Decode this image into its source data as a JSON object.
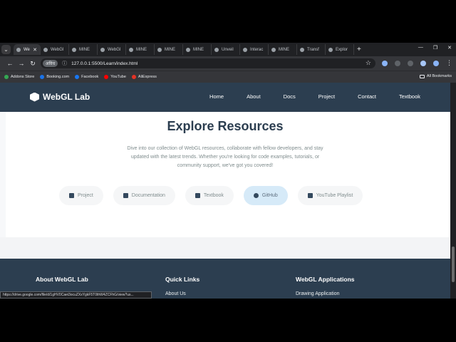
{
  "browser": {
    "tabs": [
      {
        "label": "We",
        "active": true
      },
      {
        "label": "WebGl"
      },
      {
        "label": "MINE"
      },
      {
        "label": "WebGl"
      },
      {
        "label": "MINE"
      },
      {
        "label": "MINE"
      },
      {
        "label": "MINE"
      },
      {
        "label": "Unveil"
      },
      {
        "label": "Interac"
      },
      {
        "label": "MINE"
      },
      {
        "label": "Transf"
      },
      {
        "label": "Explor"
      }
    ],
    "url": "127.0.0.1:5500/Learn/index.html",
    "chip": "अविध",
    "bookmarks": [
      {
        "label": "Addons Store",
        "color": "#34a853"
      },
      {
        "label": "Booking.com",
        "color": "#1a73e8"
      },
      {
        "label": "Facebook",
        "color": "#1877f2"
      },
      {
        "label": "YouTube",
        "color": "#ff0000"
      },
      {
        "label": "AliExpress",
        "color": "#e43225"
      }
    ],
    "all_bookmarks": "All Bookmarks",
    "status_url": "https://drive.google.com/file/d/1gHV0Caei3ocuZXsYgkF5T0thW4ZCFhG/view?us..."
  },
  "site": {
    "logo": "WebGL Lab",
    "nav": [
      "Home",
      "About",
      "Docs",
      "Project",
      "Contact",
      "Textbook"
    ],
    "heading": "Explore Resources",
    "paragraph": "Dive into our collection of WebGL resources, collaborate with fellow developers, and stay updated with the latest trends. Whether you're looking for code examples, tutorials, or community support, we've got you covered!",
    "buttons": [
      {
        "label": "Project",
        "icon": "project-diagram-icon"
      },
      {
        "label": "Documentation",
        "icon": "document-icon"
      },
      {
        "label": "Textbook",
        "icon": "book-icon"
      },
      {
        "label": "GitHub",
        "icon": "github-icon",
        "active": true
      },
      {
        "label": "YouTube Playlist",
        "icon": "youtube-icon"
      }
    ],
    "footer": {
      "about_title": "About WebGL Lab",
      "quick_title": "Quick Links",
      "quick_link": "About Us",
      "apps_title": "WebGL Applications",
      "apps_link": "Drawing Application"
    }
  }
}
